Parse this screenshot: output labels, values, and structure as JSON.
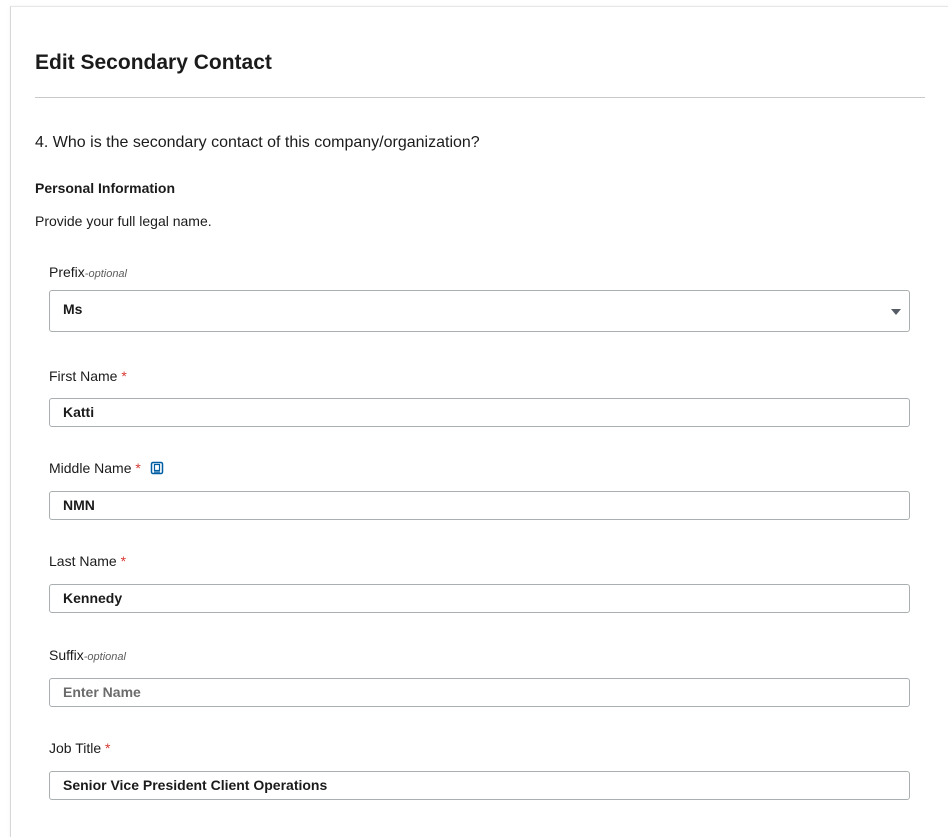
{
  "page": {
    "title": "Edit Secondary Contact",
    "question": "4. Who is the secondary contact of this company/organization?",
    "section_title": "Personal Information",
    "hint": "Provide your full legal name."
  },
  "fields": {
    "prefix": {
      "label": "Prefix",
      "qualifier": "-optional",
      "value": "Ms"
    },
    "first_name": {
      "label": "First Name",
      "required_mark": "*",
      "value": "Katti"
    },
    "middle_name": {
      "label": "Middle Name",
      "required_mark": "*",
      "value": "NMN"
    },
    "last_name": {
      "label": "Last Name",
      "required_mark": "*",
      "value": "Kennedy"
    },
    "suffix": {
      "label": "Suffix",
      "qualifier": "-optional",
      "placeholder": "Enter Name"
    },
    "job_title": {
      "label": "Job Title",
      "required_mark": "*",
      "value": "Senior Vice President Client Operations"
    }
  },
  "icons": {
    "middle_name_help": "copy-icon",
    "prefix_dropdown": "caret-down-icon"
  },
  "colors": {
    "required": "#d83933",
    "icon_accent": "#005ea2",
    "border": "#a9aeb1"
  }
}
